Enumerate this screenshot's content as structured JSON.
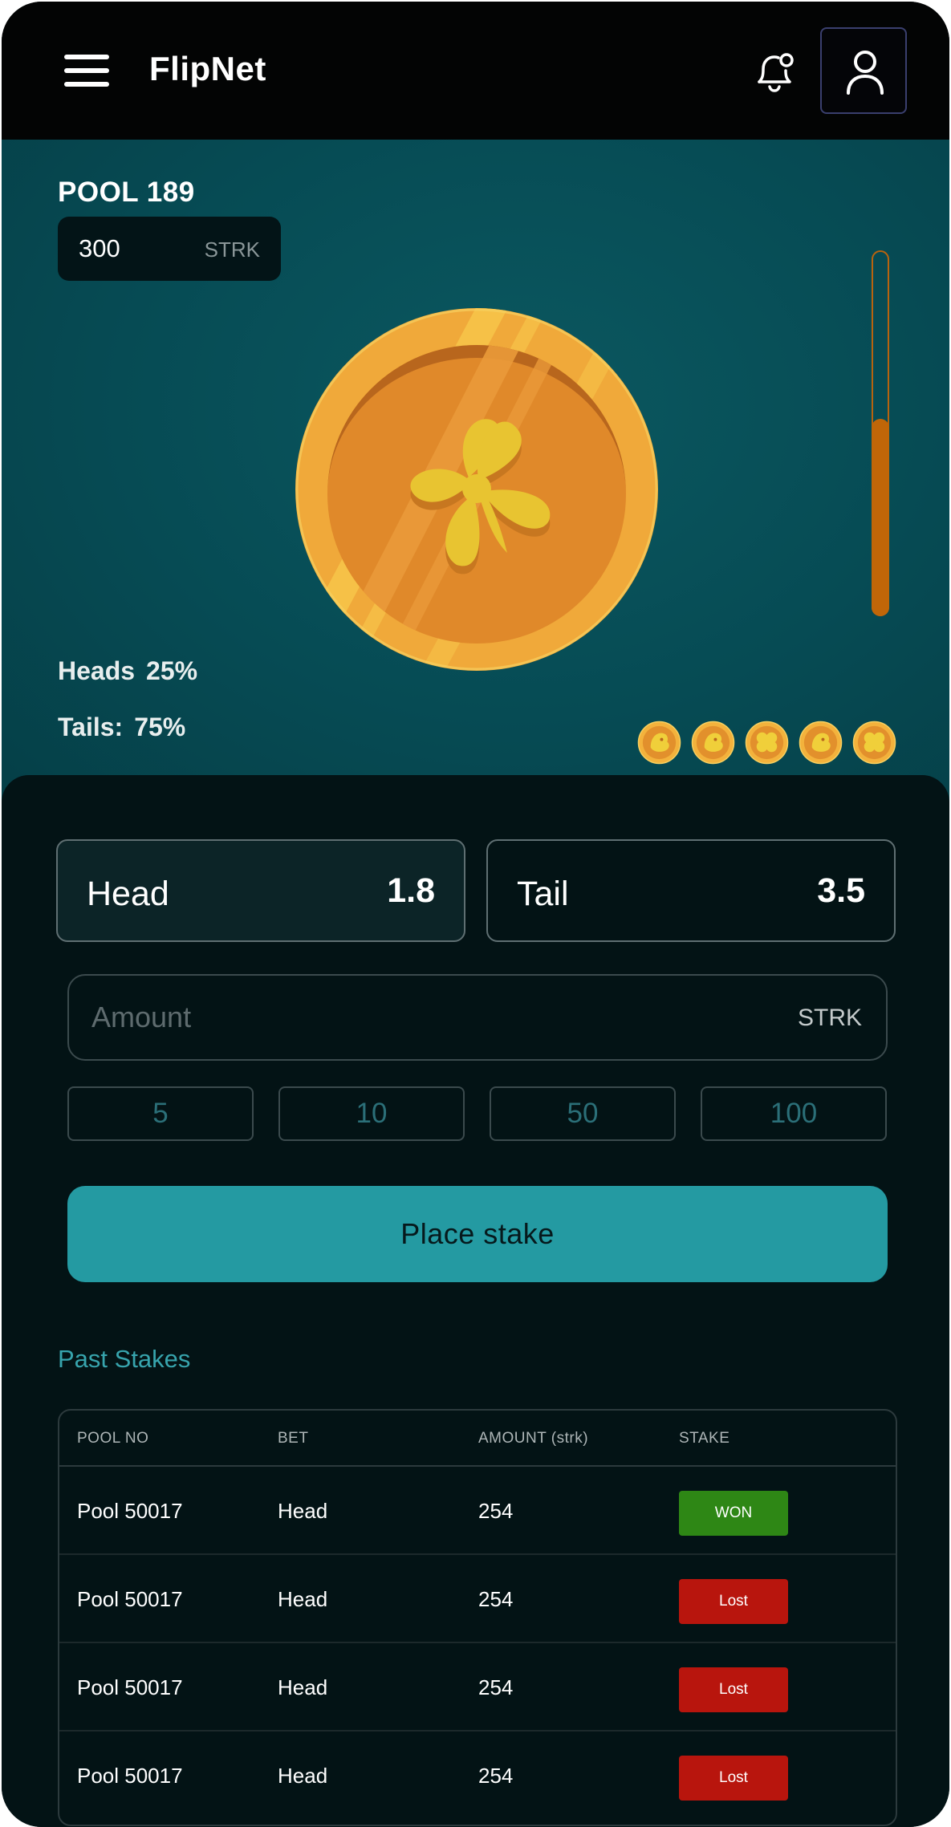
{
  "header": {
    "app_title": "FlipNet"
  },
  "pool": {
    "title": "POOL 189",
    "amount": "300",
    "unit": "STRK",
    "progress_fraction": 0.54
  },
  "odds": {
    "heads_label": "Heads",
    "heads_pct": "25%",
    "tails_label": "Tails:",
    "tails_pct": "75%"
  },
  "recent_flips": [
    "tails-face",
    "tails-face",
    "heads-clover",
    "tails-face",
    "heads-clover"
  ],
  "choices": {
    "head_label": "Head",
    "head_odd": "1.8",
    "tail_label": "Tail",
    "tail_odd": "3.5"
  },
  "amount_input": {
    "placeholder": "Amount",
    "value": "",
    "unit": "STRK"
  },
  "quick_amounts": [
    "5",
    "10",
    "50",
    "100"
  ],
  "stake_button": "Place stake",
  "past_stakes": {
    "title": "Past Stakes",
    "columns": [
      "POOL NO",
      "BET",
      "AMOUNT (strk)",
      "STAKE"
    ],
    "rows": [
      {
        "pool": "Pool 50017",
        "bet": "Head",
        "amount": "254",
        "stake": "WON"
      },
      {
        "pool": "Pool 50017",
        "bet": "Head",
        "amount": "254",
        "stake": "Lost"
      },
      {
        "pool": "Pool 50017",
        "bet": "Head",
        "amount": "254",
        "stake": "Lost"
      },
      {
        "pool": "Pool 50017",
        "bet": "Head",
        "amount": "254",
        "stake": "Lost"
      }
    ]
  },
  "colors": {
    "accent": "#249aa2",
    "won": "#2e8715",
    "lost": "#b8150d",
    "progress": "#c06608"
  }
}
